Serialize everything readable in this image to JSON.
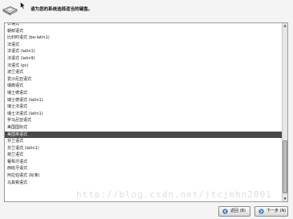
{
  "header": {
    "prompt": "请为您的系统选择适当的键盘。",
    "icon": "keyboard-icon"
  },
  "keyboard_list": {
    "items": [
      "日语式",
      "朝鲜语式",
      "比利时语式 (be-latin1)",
      "法语式",
      "法语式 (latin1)",
      "法语式 (latin9)",
      "法语式 (pc)",
      "波兰语式",
      "爱沙尼亚语式",
      "瑞典语式",
      "瑞士德语式",
      "瑞士德语式 (latin1)",
      "瑞士法语式",
      "瑞士法语式 (latin1)",
      "罗马尼亚语式",
      "美国国际式",
      "美国英语式",
      "芬兰语式",
      "芬兰语式 (latin1)",
      "荷兰语式",
      "葡萄牙语式",
      "西班牙语式",
      "阿拉伯语式 (标准)",
      "马其顿语式"
    ],
    "selected_index": 16
  },
  "buttons": {
    "back_label": "返回 (B)",
    "next_label": "下一步 (N)"
  },
  "watermark": "http://blog.csdn.net/jtcjmhn2001"
}
